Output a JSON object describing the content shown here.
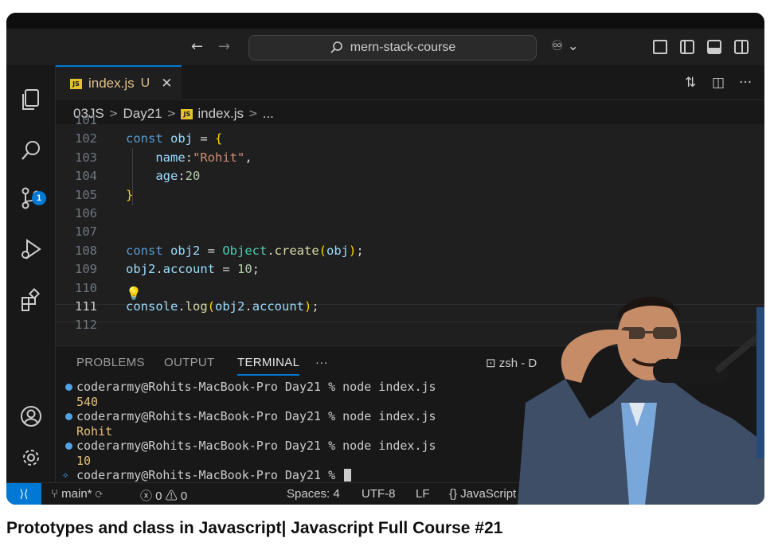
{
  "window": {
    "search_text": "mern-stack-course"
  },
  "tab": {
    "icon_text": "JS",
    "filename": "index.js",
    "status": "U"
  },
  "breadcrumb": [
    "03JS",
    "Day21",
    "index.js",
    "..."
  ],
  "activity": {
    "source_control_badge": "1"
  },
  "editor": {
    "lines": [
      {
        "n": "101"
      },
      {
        "n": "102",
        "tokens": [
          [
            "kw",
            "const "
          ],
          [
            "var",
            "obj"
          ],
          [
            "pun",
            " = "
          ],
          [
            "br",
            "{"
          ]
        ]
      },
      {
        "n": "103",
        "tokens": [
          [
            "var",
            "    name"
          ],
          [
            "pun",
            ":"
          ],
          [
            "str",
            "\"Rohit\""
          ],
          [
            "pun",
            ","
          ]
        ]
      },
      {
        "n": "104",
        "tokens": [
          [
            "var",
            "    age"
          ],
          [
            "pun",
            ":"
          ],
          [
            "num",
            "20"
          ]
        ]
      },
      {
        "n": "105",
        "tokens": [
          [
            "br",
            "}"
          ]
        ]
      },
      {
        "n": "106"
      },
      {
        "n": "107"
      },
      {
        "n": "108",
        "tokens": [
          [
            "kw",
            "const "
          ],
          [
            "var",
            "obj2"
          ],
          [
            "pun",
            " = "
          ],
          [
            "cls",
            "Object"
          ],
          [
            "pun",
            "."
          ],
          [
            "fn",
            "create"
          ],
          [
            "br",
            "("
          ],
          [
            "var",
            "obj"
          ],
          [
            "br",
            ")"
          ],
          [
            "pun",
            ";"
          ]
        ]
      },
      {
        "n": "109",
        "tokens": [
          [
            "var",
            "obj2"
          ],
          [
            "pun",
            "."
          ],
          [
            "var",
            "account"
          ],
          [
            "pun",
            " = "
          ],
          [
            "num",
            "10"
          ],
          [
            "pun",
            ";"
          ]
        ]
      },
      {
        "n": "110"
      },
      {
        "n": "111",
        "tokens": [
          [
            "var",
            "console"
          ],
          [
            "pun",
            "."
          ],
          [
            "fn",
            "log"
          ],
          [
            "br",
            "("
          ],
          [
            "var",
            "obj2"
          ],
          [
            "pun",
            "."
          ],
          [
            "var",
            "account"
          ],
          [
            "br",
            ")"
          ],
          [
            "pun",
            ";"
          ]
        ]
      },
      {
        "n": "112"
      }
    ]
  },
  "panel": {
    "tabs": [
      "PROBLEMS",
      "OUTPUT",
      "TERMINAL"
    ],
    "more": "···",
    "shell": "zsh - D"
  },
  "terminal": [
    {
      "type": "cmd",
      "text": "coderarmy@Rohits-MacBook-Pro Day21 % node index.js"
    },
    {
      "type": "out",
      "text": "540"
    },
    {
      "type": "cmd",
      "text": "coderarmy@Rohits-MacBook-Pro Day21 % node index.js"
    },
    {
      "type": "out",
      "text": "Rohit"
    },
    {
      "type": "cmd",
      "text": "coderarmy@Rohits-MacBook-Pro Day21 % node index.js"
    },
    {
      "type": "out",
      "text": "10"
    },
    {
      "type": "prompt",
      "text": "coderarmy@Rohits-MacBook-Pro Day21 % "
    }
  ],
  "statusbar": {
    "branch": "main*",
    "errors": "0",
    "warnings": "0",
    "spaces": "Spaces: 4",
    "encoding": "UTF-8",
    "eol": "LF",
    "language": "JavaScript"
  },
  "video_title": "Prototypes and class in Javascript| Javascript Full Course #21",
  "colors": {
    "accent": "#0078d4",
    "editor_bg": "#1f1f1f",
    "panel_bg": "#181818"
  }
}
